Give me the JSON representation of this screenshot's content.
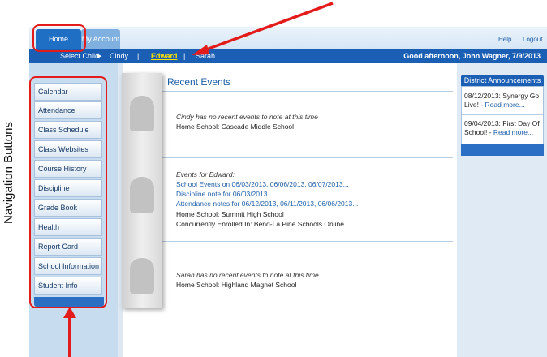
{
  "header": {
    "tabs": [
      "Home",
      "My Account"
    ],
    "links": [
      "Help",
      "Logout"
    ]
  },
  "child_bar": {
    "select_label": "Select Child",
    "children": [
      "Cindy",
      "Edward",
      "Sarah"
    ],
    "separator": "|",
    "greeting": "Good afternoon, John Wagner, 7/9/2013"
  },
  "nav": {
    "items": [
      "Calendar",
      "Attendance",
      "Class Schedule",
      "Class Websites",
      "Course History",
      "Discipline",
      "Grade Book",
      "Health",
      "Report Card",
      "School Information",
      "Student Info"
    ]
  },
  "events": {
    "title": "Recent Events",
    "cindy": {
      "note": "Cindy has no recent events to note at this time",
      "school": "Home School: Cascade Middle School"
    },
    "edward": {
      "heading": "Events for Edward:",
      "links": [
        "School Events on 06/03/2013, 06/06/2013, 06/07/2013...",
        "Discipline note for 06/03/2013",
        "Attendance notes for 06/12/2013, 06/11/2013, 06/06/2013..."
      ],
      "school": "Home School: Summit High School",
      "concurrent": "Concurrently Enrolled In: Bend-La Pine Schools Online"
    },
    "sarah": {
      "note": "Sarah has no recent events to note at this time",
      "school": "Home School: Highland Magnet School"
    }
  },
  "announcements": {
    "title": "District Announcements",
    "items": [
      {
        "text": "08/12/2013: Synergy Go Live! -",
        "link": "Read more..."
      },
      {
        "text": "09/04/2013: First Day Of School! -",
        "link": "Read more..."
      }
    ]
  },
  "overlay": {
    "label": "Navigation Buttons",
    "highlight_color": "#e31b1b"
  }
}
